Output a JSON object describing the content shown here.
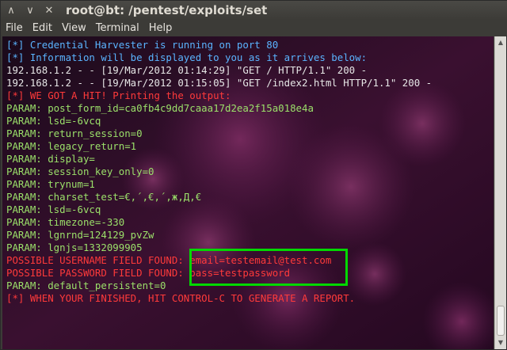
{
  "window": {
    "title": "root@bt: /pentest/exploits/set",
    "controls": {
      "close": "✕",
      "minimize": "∨",
      "maximize": "∧"
    }
  },
  "menu": [
    "File",
    "Edit",
    "View",
    "Terminal",
    "Help"
  ],
  "terminal": {
    "lines": [
      {
        "text": "[*] Credential Harvester is running on port 80",
        "color": "#5ab4ff"
      },
      {
        "text": "[*] Information will be displayed to you as it arrives below:",
        "color": "#5ab4ff"
      },
      {
        "text": "192.168.1.2 - - [19/Mar/2012 01:14:29] \"GET / HTTP/1.1\" 200 -",
        "color": "#e6e6e6"
      },
      {
        "text": "192.168.1.2 - - [19/Mar/2012 01:15:05] \"GET /index2.html HTTP/1.1\" 200 -",
        "color": "#e6e6e6"
      },
      {
        "text": "[*] WE GOT A HIT! Printing the output:",
        "color": "#ff3a3a"
      },
      {
        "text": "PARAM: post_form_id=ca0fb4c9dd7caaa17d2ea2f15a018e4a",
        "color": "#9be06a"
      },
      {
        "text": "PARAM: lsd=-6vcq",
        "color": "#9be06a"
      },
      {
        "text": "PARAM: return_session=0",
        "color": "#9be06a"
      },
      {
        "text": "PARAM: legacy_return=1",
        "color": "#9be06a"
      },
      {
        "text": "PARAM: display=",
        "color": "#9be06a"
      },
      {
        "text": "PARAM: session_key_only=0",
        "color": "#9be06a"
      },
      {
        "text": "PARAM: trynum=1",
        "color": "#9be06a"
      },
      {
        "text": "PARAM: charset_test=€,´,€,´,ж,Д,€",
        "color": "#9be06a"
      },
      {
        "text": "PARAM: lsd=-6vcq",
        "color": "#9be06a"
      },
      {
        "text": "PARAM: timezone=-330",
        "color": "#9be06a"
      },
      {
        "text": "PARAM: lgnrnd=124129_pvZw",
        "color": "#9be06a"
      },
      {
        "text": "PARAM: lgnjs=1332099905",
        "color": "#9be06a"
      },
      {
        "text": "POSSIBLE USERNAME FIELD FOUND: email=testemail@test.com",
        "color": "#ff3a3a"
      },
      {
        "text": "POSSIBLE PASSWORD FIELD FOUND: pass=testpassword",
        "color": "#ff3a3a"
      },
      {
        "text": "PARAM: default_persistent=0",
        "color": "#9be06a"
      },
      {
        "text": "[*] WHEN YOUR FINISHED, HIT CONTROL-C TO GENERATE A REPORT.",
        "color": "#ff3a3a"
      }
    ],
    "highlight_color": "#00d800",
    "background_color": "#2a0a22"
  },
  "scrollbar": {
    "up_icon": "up-arrow-icon",
    "down_icon": "down-arrow-icon"
  }
}
